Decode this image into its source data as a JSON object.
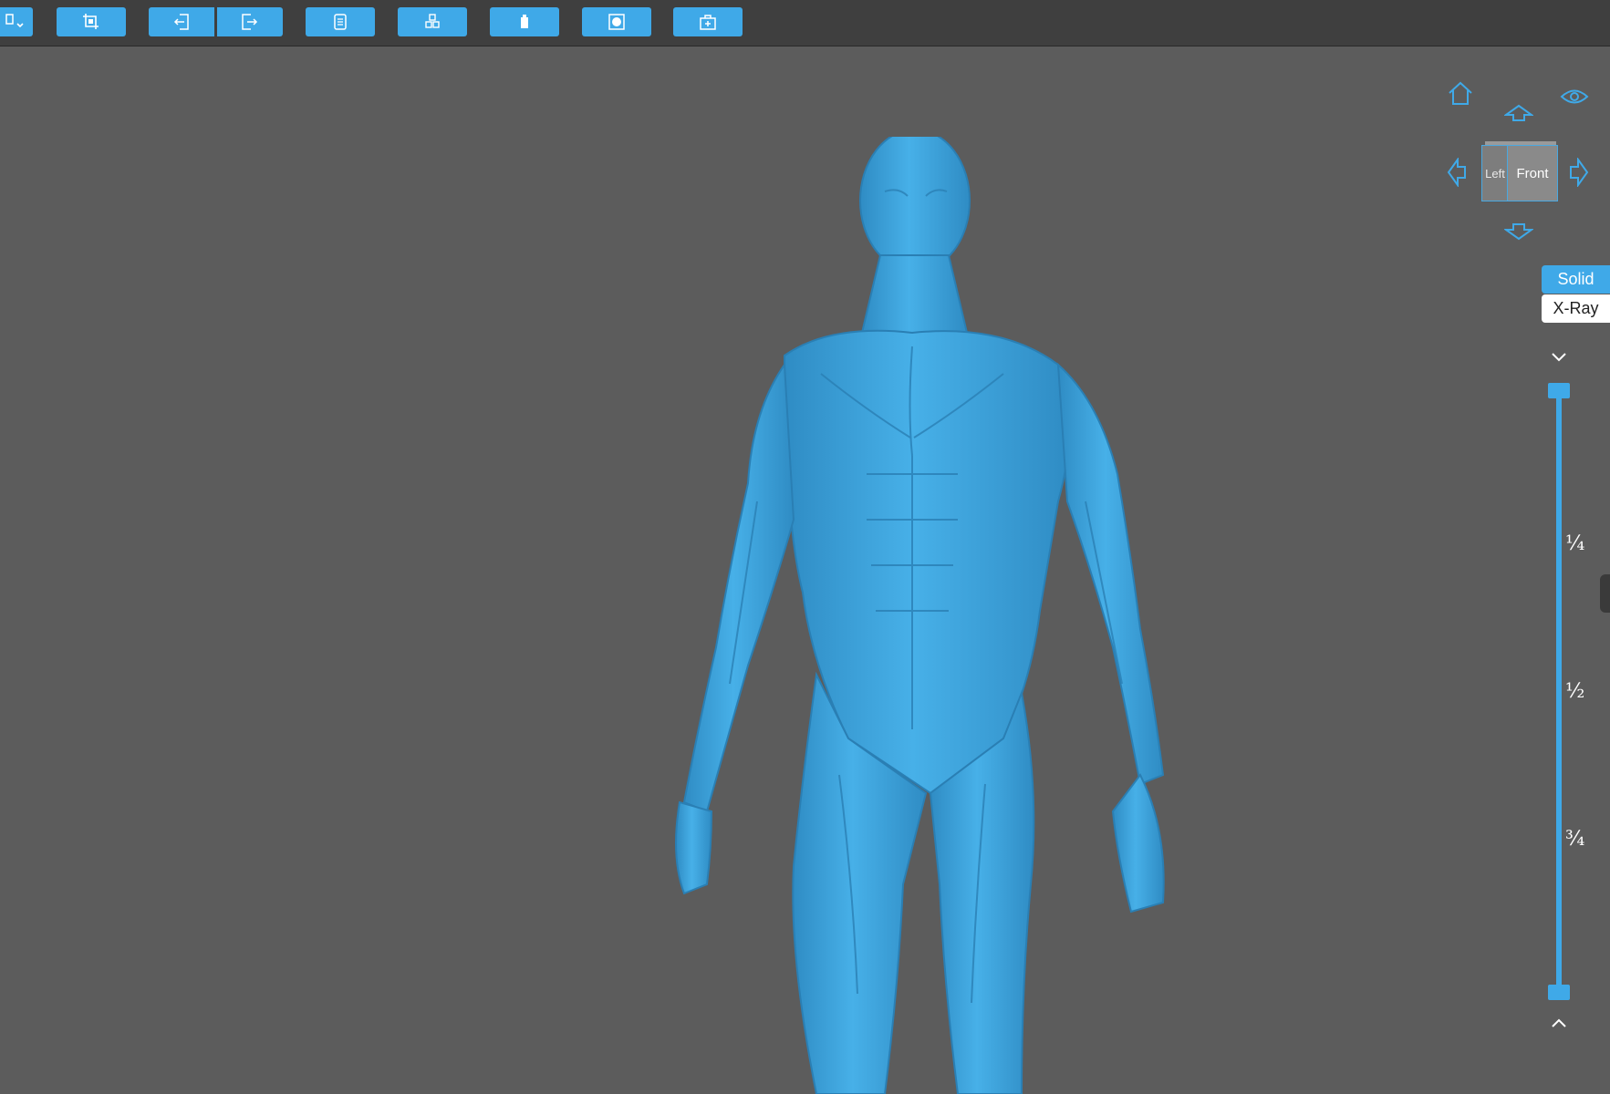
{
  "toolbar": {
    "buttons": [
      {
        "name": "file-dropdown-button",
        "icon": "file-icon"
      },
      {
        "name": "crop-button",
        "icon": "crop-icon"
      },
      {
        "name": "import-button",
        "icon": "import-icon"
      },
      {
        "name": "export-button",
        "icon": "export-icon"
      },
      {
        "name": "document-button",
        "icon": "document-icon"
      },
      {
        "name": "cubes-button",
        "icon": "cubes-icon"
      },
      {
        "name": "clipboard-button",
        "icon": "clipboard-icon"
      },
      {
        "name": "record-button",
        "icon": "record-icon"
      },
      {
        "name": "add-box-button",
        "icon": "add-box-icon"
      }
    ]
  },
  "view_cube": {
    "left_label": "Left",
    "front_label": "Front"
  },
  "render_mode": {
    "solid_label": "Solid",
    "xray_label": "X-Ray",
    "active": "Solid"
  },
  "slider": {
    "labels": [
      "¼",
      "½",
      "¾"
    ]
  },
  "colors": {
    "accent": "#3fa9e8",
    "model": "#3d9fd6",
    "background": "#5c5c5c",
    "toolbar": "#3f3f3f"
  }
}
